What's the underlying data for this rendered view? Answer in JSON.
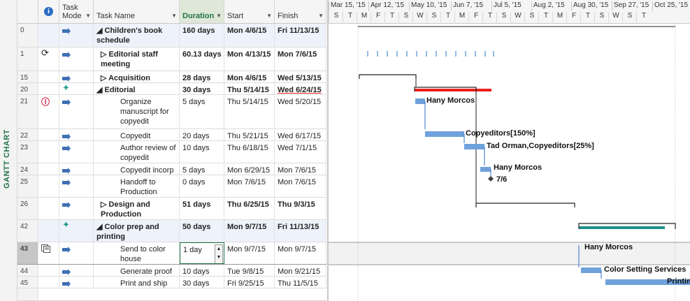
{
  "side_label": "GANTT CHART",
  "columns": {
    "info_icon": "info-icon",
    "task_mode": "Task Mode",
    "task_name": "Task Name",
    "duration": "Duration",
    "start": "Start",
    "finish": "Finish"
  },
  "rows": [
    {
      "id": "0",
      "name": "◢ Children's book schedule",
      "duration": "160 days",
      "start": "Mon 4/6/15",
      "finish": "Fri 11/13/15"
    },
    {
      "id": "1",
      "name": "▷ Editorial staff meeting",
      "duration": "60.13 days",
      "start": "Mon 4/13/15",
      "finish": "Mon 7/6/15"
    },
    {
      "id": "15",
      "name": "▷ Acquisition",
      "duration": "28 days",
      "start": "Mon 4/6/15",
      "finish": "Wed 5/13/15"
    },
    {
      "id": "20",
      "name": "◢ Editorial",
      "duration": "30 days",
      "start": "Thu 5/14/15",
      "finish": "Wed 6/24/15"
    },
    {
      "id": "21",
      "name": "Organize manuscript for copyedit",
      "duration": "5 days",
      "start": "Thu 5/14/15",
      "finish": "Wed 5/20/15"
    },
    {
      "id": "22",
      "name": "Copyedit",
      "duration": "20 days",
      "start": "Thu 5/21/15",
      "finish": "Wed 6/17/15"
    },
    {
      "id": "23",
      "name": "Author review of copyedit",
      "duration": "10 days",
      "start": "Thu 6/18/15",
      "finish": "Wed 7/1/15"
    },
    {
      "id": "24",
      "name": "Copyedit incorp",
      "duration": "5 days",
      "start": "Mon 6/29/15",
      "finish": "Mon 7/6/15"
    },
    {
      "id": "25",
      "name": "Handoff to Production",
      "duration": "0 days",
      "start": "Mon 7/6/15",
      "finish": "Mon 7/6/15"
    },
    {
      "id": "26",
      "name": "▷ Design and Production",
      "duration": "51 days",
      "start": "Thu 6/25/15",
      "finish": "Thu 9/3/15"
    },
    {
      "id": "42",
      "name": "◢ Color prep and printing",
      "duration": "50 days",
      "start": "Mon 9/7/15",
      "finish": "Fri 11/13/15"
    },
    {
      "id": "43",
      "name": "Send to color house",
      "duration": "1 day",
      "start": "Mon 9/7/15",
      "finish": "Mon 9/7/15"
    },
    {
      "id": "44",
      "name": "Generate proof",
      "duration": "10 days",
      "start": "Tue 9/8/15",
      "finish": "Mon 9/21/15"
    },
    {
      "id": "45",
      "name": "Print and ship",
      "duration": "30 days",
      "start": "Fri 9/25/15",
      "finish": "Thu 11/5/15"
    }
  ],
  "timescale": {
    "major": [
      "Mar 15, '15",
      "Apr 12, '15",
      "May 10, '15",
      "Jun 7, '15",
      "Jul 5, '15",
      "Aug 2, '15",
      "Aug 30, '15",
      "Sep 27, '15",
      "Oct 25, '15"
    ],
    "minor": [
      "S",
      "T",
      "M",
      "F",
      "T",
      "S",
      "W",
      "S",
      "T",
      "M",
      "F",
      "T",
      "S",
      "W",
      "S",
      "T",
      "M",
      "F",
      "T",
      "S",
      "W",
      "S",
      "T"
    ]
  },
  "gantt_labels": {
    "r21": "Hany Morcos",
    "r22": "Copyeditors[150%]",
    "r23": "Tad Orman,Copyeditors[25%]",
    "r24": "Hany Morcos",
    "r25": "7/6",
    "r43": "Hany Morcos",
    "r44": "Color Setting Services",
    "r45": "Printin"
  },
  "colors": {
    "accent_green": "#217346",
    "task_bar": "#6fa2dc",
    "critical_bar": "#e8211d",
    "summary_bar": "#1e8f8a"
  }
}
